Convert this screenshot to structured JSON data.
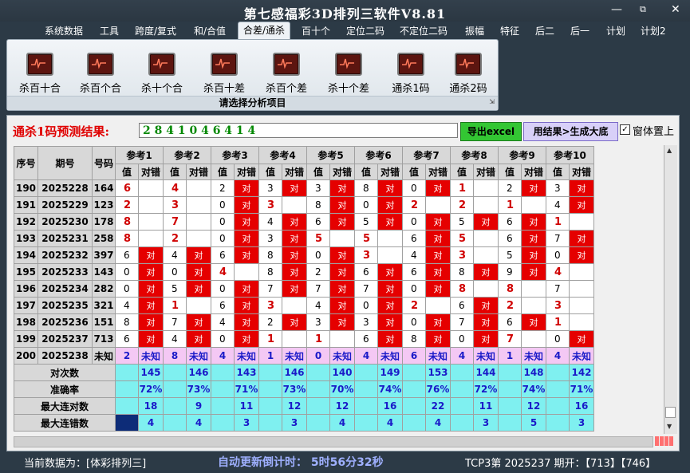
{
  "window": {
    "title": "第七感福彩3D排列三软件V8.81",
    "min_icon": "minimize-icon",
    "max_icon": "maximize-icon",
    "close_icon": "close-icon"
  },
  "menu": [
    "系统数据",
    "工具",
    "跨度/复式",
    "和/合值",
    "合差/通杀",
    "百十个",
    "定位二码",
    "不定位二码",
    "振幅",
    "特征",
    "后二",
    "后一",
    "计划",
    "计划2"
  ],
  "active_menu": "合差/通杀",
  "ribbon": {
    "buttons": [
      "杀百十合",
      "杀百个合",
      "杀十个合",
      "杀百十差",
      "杀百个差",
      "杀十个差",
      "通杀1码",
      "通杀2码"
    ],
    "footer": "请选择分析项目",
    "icon": "chart-icon"
  },
  "prediction": {
    "label": "通杀1码预测结果:",
    "value": "2 8 4 1 0 4 6 4 1 4",
    "export_button": "导出excel",
    "generate_button": "用结果>生成大底",
    "topmost_label": "窗体置上",
    "topmost_checked": true
  },
  "table": {
    "headers": {
      "seq": "序号",
      "period": "期号",
      "number": "号码",
      "ref_prefix": "参考",
      "value": "值",
      "hit": "对错"
    },
    "refs": [
      "参考1",
      "参考2",
      "参考3",
      "参考4",
      "参考5",
      "参考6",
      "参考7",
      "参考8",
      "参考9",
      "参考10"
    ],
    "rows": [
      {
        "seq": "190",
        "period": "2025228",
        "num": "164",
        "vals": [
          "6",
          "4",
          "2",
          "3",
          "3",
          "8",
          "0",
          "1",
          "2",
          "3"
        ],
        "hits": [
          "",
          "",
          "对",
          "对",
          "对",
          "对",
          "对",
          "",
          "对",
          "对"
        ]
      },
      {
        "seq": "191",
        "period": "2025229",
        "num": "123",
        "vals": [
          "2",
          "3",
          "0",
          "3",
          "8",
          "0",
          "2",
          "2",
          "1",
          "4"
        ],
        "hits": [
          "",
          "",
          "对",
          "",
          "对",
          "对",
          "",
          "",
          "",
          "对"
        ]
      },
      {
        "seq": "192",
        "period": "2025230",
        "num": "178",
        "vals": [
          "8",
          "7",
          "0",
          "4",
          "6",
          "5",
          "0",
          "5",
          "6",
          "1"
        ],
        "hits": [
          "",
          "",
          "对",
          "对",
          "对",
          "对",
          "对",
          "对",
          "对",
          ""
        ]
      },
      {
        "seq": "193",
        "period": "2025231",
        "num": "258",
        "vals": [
          "8",
          "2",
          "0",
          "3",
          "5",
          "5",
          "6",
          "5",
          "6",
          "7"
        ],
        "hits": [
          "",
          "",
          "对",
          "对",
          "",
          "",
          "对",
          "",
          "对",
          "对"
        ]
      },
      {
        "seq": "194",
        "period": "2025232",
        "num": "397",
        "vals": [
          "6",
          "4",
          "6",
          "8",
          "0",
          "3",
          "4",
          "3",
          "5",
          "0"
        ],
        "hits": [
          "对",
          "对",
          "对",
          "对",
          "对",
          "",
          "对",
          "",
          "对",
          "对"
        ]
      },
      {
        "seq": "195",
        "period": "2025233",
        "num": "143",
        "vals": [
          "0",
          "0",
          "4",
          "8",
          "2",
          "6",
          "6",
          "8",
          "9",
          "4"
        ],
        "hits": [
          "对",
          "对",
          "",
          "对",
          "对",
          "对",
          "对",
          "对",
          "对",
          ""
        ]
      },
      {
        "seq": "196",
        "period": "2025234",
        "num": "282",
        "vals": [
          "0",
          "5",
          "0",
          "7",
          "7",
          "7",
          "0",
          "8",
          "8",
          "7"
        ],
        "hits": [
          "对",
          "对",
          "对",
          "对",
          "对",
          "对",
          "对",
          "",
          "",
          ""
        ]
      },
      {
        "seq": "197",
        "period": "2025235",
        "num": "321",
        "vals": [
          "4",
          "1",
          "6",
          "3",
          "4",
          "0",
          "2",
          "6",
          "2",
          "3"
        ],
        "hits": [
          "对",
          "",
          "对",
          "",
          "对",
          "对",
          "",
          "对",
          "",
          ""
        ]
      },
      {
        "seq": "198",
        "period": "2025236",
        "num": "151",
        "vals": [
          "8",
          "7",
          "4",
          "2",
          "3",
          "3",
          "0",
          "7",
          "6",
          "1"
        ],
        "hits": [
          "对",
          "对",
          "对",
          "对",
          "对",
          "对",
          "对",
          "对",
          "对",
          ""
        ]
      },
      {
        "seq": "199",
        "period": "2025237",
        "num": "713",
        "vals": [
          "6",
          "4",
          "0",
          "1",
          "1",
          "6",
          "8",
          "0",
          "7",
          "0"
        ],
        "hits": [
          "对",
          "对",
          "对",
          "",
          "",
          "对",
          "对",
          "对",
          "",
          "对"
        ]
      },
      {
        "seq": "200",
        "period": "2025238",
        "num": "未知",
        "vals": [
          "2",
          "8",
          "4",
          "1",
          "0",
          "4",
          "6",
          "4",
          "1",
          "4"
        ],
        "hits": [
          "未知",
          "未知",
          "未知",
          "未知",
          "未知",
          "未知",
          "未知",
          "未知",
          "未知",
          "未知"
        ]
      }
    ],
    "red_vals": [
      [
        true,
        true,
        false,
        false,
        false,
        false,
        false,
        true,
        false,
        false
      ],
      [
        true,
        true,
        false,
        true,
        false,
        false,
        true,
        true,
        true,
        false
      ],
      [
        true,
        true,
        false,
        false,
        false,
        false,
        false,
        false,
        false,
        true
      ],
      [
        true,
        true,
        false,
        false,
        true,
        true,
        false,
        true,
        false,
        false
      ],
      [
        false,
        false,
        false,
        false,
        false,
        true,
        false,
        true,
        false,
        false
      ],
      [
        false,
        false,
        true,
        false,
        false,
        false,
        false,
        false,
        false,
        true
      ],
      [
        false,
        false,
        false,
        false,
        false,
        false,
        false,
        true,
        true,
        false
      ],
      [
        false,
        true,
        false,
        true,
        false,
        false,
        true,
        false,
        true,
        true
      ],
      [
        false,
        false,
        false,
        false,
        false,
        false,
        false,
        false,
        false,
        true
      ],
      [
        false,
        false,
        false,
        true,
        true,
        false,
        false,
        false,
        true,
        false
      ]
    ],
    "summary": [
      {
        "label": "对次数",
        "values": [
          "145",
          "146",
          "143",
          "146",
          "140",
          "149",
          "153",
          "144",
          "148",
          "142"
        ]
      },
      {
        "label": "准确率",
        "values": [
          "72%",
          "73%",
          "71%",
          "73%",
          "70%",
          "74%",
          "76%",
          "72%",
          "74%",
          "71%"
        ]
      },
      {
        "label": "最大连对数",
        "values": [
          "18",
          "9",
          "11",
          "12",
          "12",
          "16",
          "22",
          "11",
          "12",
          "16"
        ]
      },
      {
        "label": "最大连错数",
        "values": [
          "4",
          "4",
          "3",
          "3",
          "4",
          "4",
          "4",
          "3",
          "5",
          "3"
        ]
      }
    ]
  },
  "status": {
    "data_source": "当前数据为：[体彩排列三]",
    "countdown": "自动更新倒计时：  5时56分32秒",
    "draw": "TCP3第 2025237 期开：【713】【746】"
  }
}
